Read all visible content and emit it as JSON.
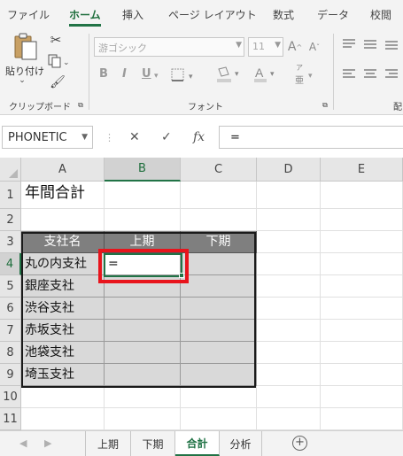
{
  "ribbon_tabs": [
    "ファイル",
    "ホーム",
    "挿入",
    "ページ レイアウト",
    "数式",
    "データ",
    "校閲"
  ],
  "active_tab": "ホーム",
  "clipboard": {
    "paste_label": "貼り付け",
    "group_label": "クリップボード"
  },
  "font": {
    "name": "游ゴシック",
    "size": "11",
    "group_label": "フォント",
    "bold": "B",
    "italic": "I",
    "underline": "U",
    "grow": "A",
    "shrink": "A",
    "color": "A",
    "phonetic": "ア",
    "phonetic_sub": "亜"
  },
  "alignment": {
    "group_label": "配"
  },
  "formula_bar": {
    "name_box": "PHONETIC",
    "cancel": "✕",
    "enter": "✓",
    "fx": "fx",
    "formula": "="
  },
  "columns": [
    "A",
    "B",
    "C",
    "D",
    "E"
  ],
  "rows": [
    "1",
    "2",
    "3",
    "4",
    "5",
    "6",
    "7",
    "8",
    "9",
    "10",
    "11"
  ],
  "cells": {
    "A1": "年間合計",
    "A3": "支社名",
    "B3": "上期",
    "C3": "下期",
    "A4": "丸の内支社",
    "B4": "=",
    "A5": "銀座支社",
    "A6": "渋谷支社",
    "A7": "赤坂支社",
    "A8": "池袋支社",
    "A9": "埼玉支社"
  },
  "sheet_tabs": [
    "上期",
    "下期",
    "合計",
    "分析"
  ],
  "active_sheet": "合計",
  "colors": {
    "accent": "#217346",
    "highlight": "#e8141c",
    "table_header": "#7f7f7f",
    "table_body": "#d9d9d9"
  }
}
